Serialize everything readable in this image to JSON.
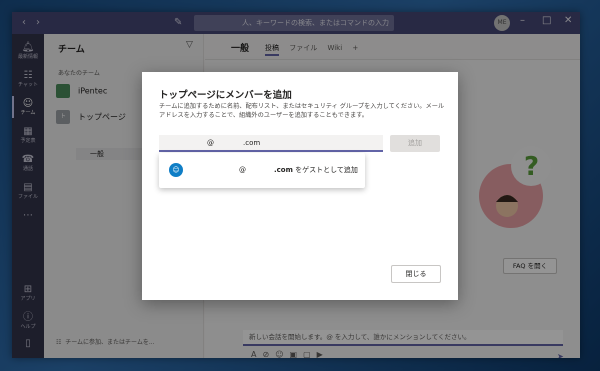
{
  "search": {
    "placeholder": "人、キーワードの検索、またはコマンドの入力"
  },
  "titlebar": {
    "avatar_initials": "ME"
  },
  "rail": {
    "items": [
      {
        "label": "最新情報",
        "icon": "bell-icon"
      },
      {
        "label": "チャット",
        "icon": "chat-icon"
      },
      {
        "label": "チーム",
        "icon": "people-icon"
      },
      {
        "label": "予定表",
        "icon": "calendar-icon"
      },
      {
        "label": "通話",
        "icon": "phone-icon"
      },
      {
        "label": "ファイル",
        "icon": "file-icon"
      },
      {
        "label": "アプリ",
        "icon": "apps-icon"
      },
      {
        "label": "ヘルプ",
        "icon": "help-icon"
      }
    ]
  },
  "teams": {
    "title": "チーム",
    "section": "あなたのチーム",
    "team1": "iPentec",
    "team2": "トップページ",
    "channel": "一般",
    "footer": "チームに参加、またはチームを..."
  },
  "channel": {
    "title": "一般",
    "tabs": [
      "投稿",
      "ファイル",
      "Wiki"
    ],
    "faq_button": "FAQ を開く",
    "compose_placeholder": "新しい会話を開始します。@ を入力して、誰かにメンションしてください。"
  },
  "dialog": {
    "title": "トップページにメンバーを追加",
    "description": "チームに追加するために名前、配布リスト、またはセキュリティ グループを入力してください。メールアドレスを入力することで、組織外のユーザーを追加することもできます。",
    "input_at": "@",
    "input_domain": ".com",
    "add_button": "追加",
    "suggestion_at": "@",
    "suggestion_domain": ".com",
    "suggestion_suffix": " をゲストとして追加",
    "close_button": "閉じる"
  },
  "colors": {
    "accent": "#6264a7",
    "titlebar": "#464775",
    "rail": "#33344a",
    "guest_avatar": "#0f7ec6"
  }
}
